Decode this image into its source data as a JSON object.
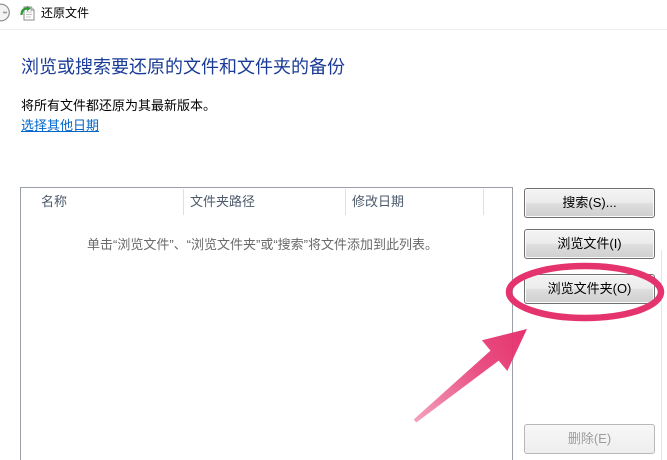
{
  "window": {
    "title": "还原文件"
  },
  "icons": {
    "back": "back-arrow-icon",
    "app": "restore-files-icon"
  },
  "main": {
    "instruction": "浏览或搜索要还原的文件和文件夹的备份",
    "description": "将所有文件都还原为其最新版本。",
    "choose_date_link": "选择其他日期"
  },
  "file_list": {
    "columns": [
      "名称",
      "文件夹路径",
      "修改日期"
    ],
    "empty_text": "单击“浏览文件”、“浏览文件夹”或“搜索”将文件添加到此列表。"
  },
  "buttons": {
    "search": {
      "label": "搜索(S)...",
      "enabled": true
    },
    "browse_files": {
      "label": "浏览文件(I)",
      "enabled": true
    },
    "browse_folders": {
      "label": "浏览文件夹(O)",
      "enabled": true
    },
    "remove": {
      "label": "删除(E)",
      "enabled": false
    }
  },
  "annotation": {
    "color": "#e5336e"
  },
  "colors": {
    "instruction_text": "#1a3c96",
    "link_text": "#0066cc",
    "disabled_text": "#9c9c9c"
  }
}
